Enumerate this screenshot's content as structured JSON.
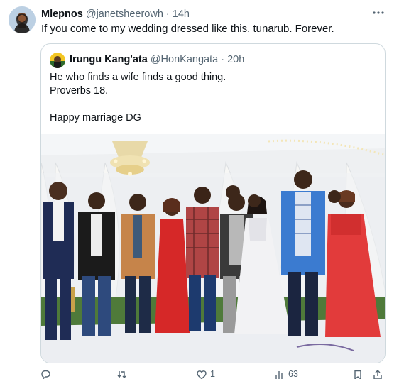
{
  "tweet": {
    "author_name": "Mlepnos",
    "author_handle": "@janetsheerowh",
    "separator": "·",
    "time": "14h",
    "text": "If you come to my wedding dressed like this, tunarub. Forever."
  },
  "quoted_tweet": {
    "author_name": "Irungu Kang'ata",
    "author_handle": "@HonKangata",
    "separator": "·",
    "time": "20h",
    "lines": [
      "He who finds a wife finds a good thing.",
      "Proverbs 18.",
      "",
      "Happy marriage DG"
    ]
  },
  "actions": {
    "reply_count": "",
    "retweet_count": "",
    "like_count": "1",
    "views_count": "63"
  },
  "icons": {
    "more": "more-horizontal-icon",
    "reply": "reply-icon",
    "retweet": "retweet-icon",
    "like": "heart-icon",
    "views": "views-icon",
    "bookmark": "bookmark-icon",
    "share": "share-icon"
  },
  "colors": {
    "text_primary": "#0f1419",
    "text_secondary": "#536471",
    "border": "#cfd9de"
  }
}
